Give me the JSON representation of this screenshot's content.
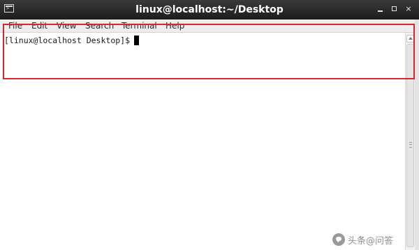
{
  "window": {
    "title": "linux@localhost:~/Desktop",
    "icon": "terminal-icon",
    "controls": {
      "minimize": "minimize-icon",
      "maximize": "maximize-icon",
      "close_glyph": "×"
    }
  },
  "menubar": {
    "items": [
      "File",
      "Edit",
      "View",
      "Search",
      "Terminal",
      "Help"
    ]
  },
  "terminal": {
    "prompt": "[linux@localhost Desktop]$"
  },
  "annotation": {
    "highlight_color": "#d7262e"
  },
  "watermark": {
    "text": "头条@问答"
  }
}
